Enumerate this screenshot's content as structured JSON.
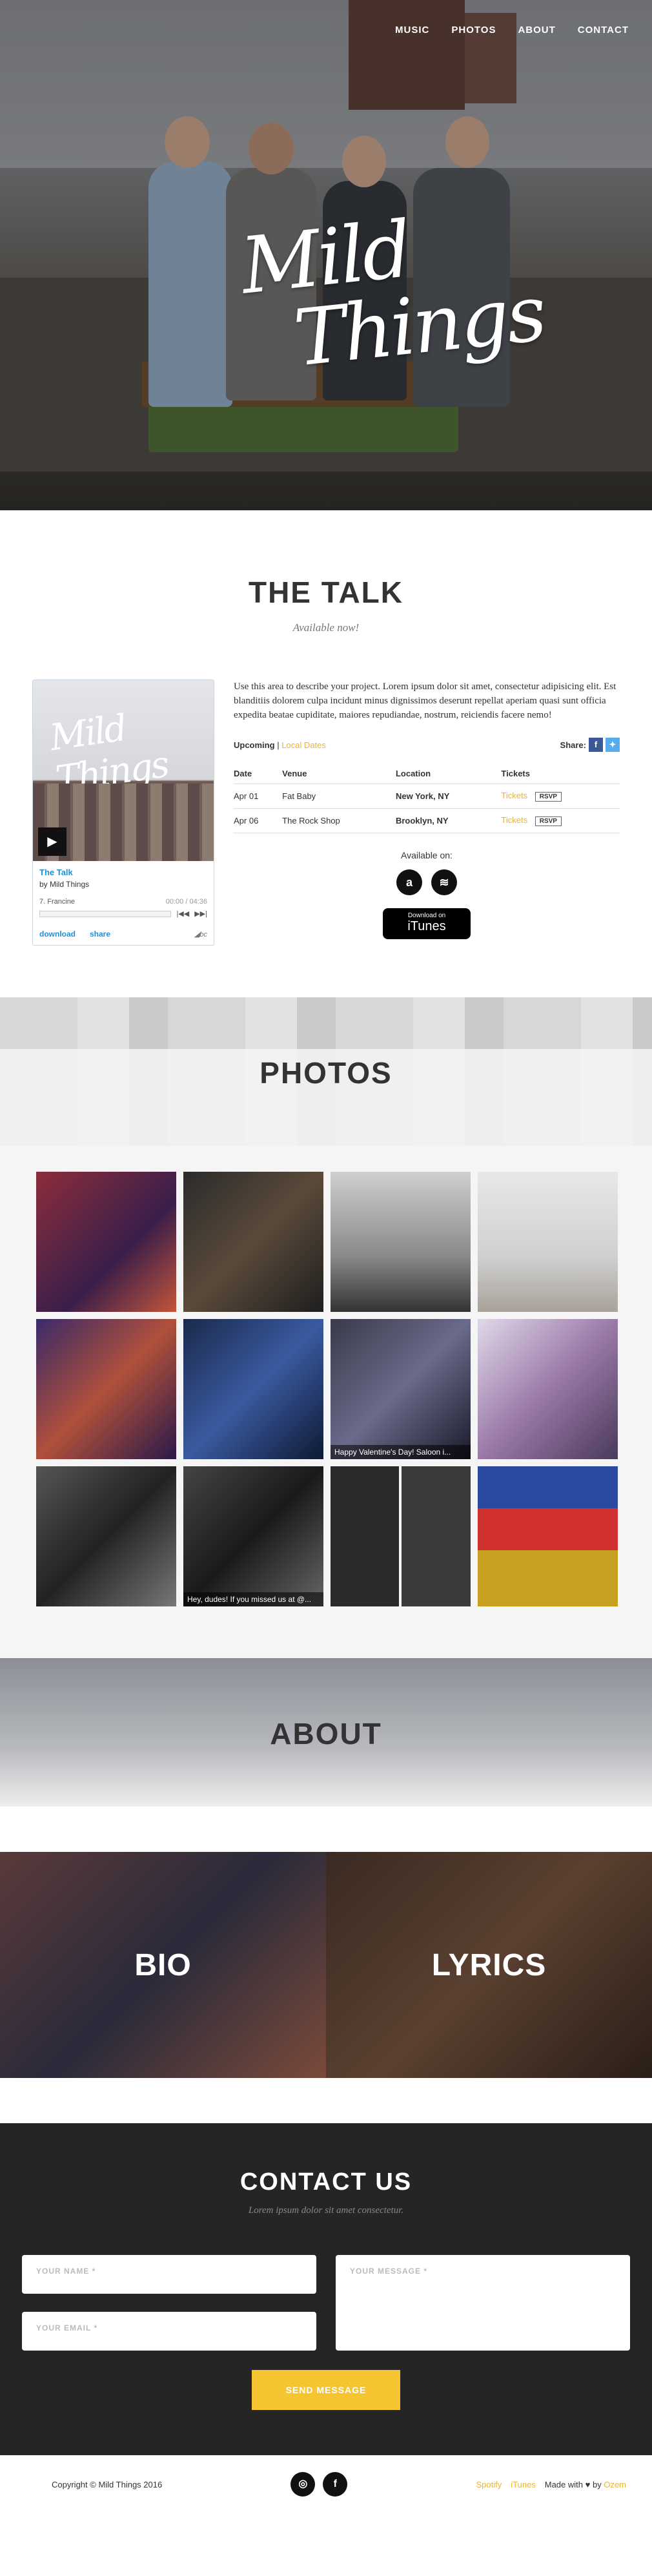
{
  "nav": {
    "items": [
      "MUSIC",
      "PHOTOS",
      "ABOUT",
      "CONTACT"
    ]
  },
  "hero": {
    "logo_line1": "Mild",
    "logo_line2": "Things"
  },
  "talk": {
    "title": "THE TALK",
    "subtitle": "Available now!",
    "player": {
      "album": "The Talk",
      "artist": "by Mild Things",
      "track": "7. Francine",
      "time": "00:00 / 04:36",
      "download": "download",
      "share": "share"
    },
    "description": "Use this area to describe your project. Lorem ipsum dolor sit amet, consectetur adipisicing elit. Est blanditiis dolorem culpa incidunt minus dignissimos deserunt repellat aperiam quasi sunt officia expedita beatae cupiditate, maiores repudiandae, nostrum, reiciendis facere nemo!",
    "tab_upcoming": "Upcoming",
    "tab_sep": "|",
    "tab_local": "Local Dates",
    "share_label": "Share:",
    "table_headers": [
      "Date",
      "Venue",
      "Location",
      "Tickets"
    ],
    "shows": [
      {
        "date": "Apr 01",
        "venue": "Fat Baby",
        "location": "New York, NY",
        "tickets": "Tickets",
        "rsvp": "RSVP"
      },
      {
        "date": "Apr 06",
        "venue": "The Rock Shop",
        "location": "Brooklyn, NY",
        "tickets": "Tickets",
        "rsvp": "RSVP"
      }
    ],
    "available_on": "Available on:",
    "itunes_small": "Download on",
    "itunes_big": "iTunes"
  },
  "photos": {
    "title": "PHOTOS",
    "captions": [
      "",
      "",
      "",
      "",
      "",
      "",
      "Happy Valentine's Day! Saloon i...",
      "",
      "",
      "Hey, dudes! If you missed us at @...",
      "",
      ""
    ]
  },
  "about": {
    "title": "ABOUT",
    "tiles": [
      "BIO",
      "LYRICS"
    ]
  },
  "contact": {
    "title": "CONTACT US",
    "subtitle": "Lorem ipsum dolor sit amet consectetur.",
    "name_placeholder": "YOUR NAME *",
    "email_placeholder": "YOUR EMAIL *",
    "message_placeholder": "YOUR MESSAGE *",
    "send": "SEND MESSAGE"
  },
  "footer": {
    "copyright": "Copyright © Mild Things 2016",
    "spotify": "Spotify",
    "itunes": "iTunes",
    "made_with": "Made with",
    "by": "by",
    "author": "Ozem"
  },
  "colors": {
    "accent": "#f5c531",
    "link": "#1e90d6",
    "dark": "#252525"
  }
}
